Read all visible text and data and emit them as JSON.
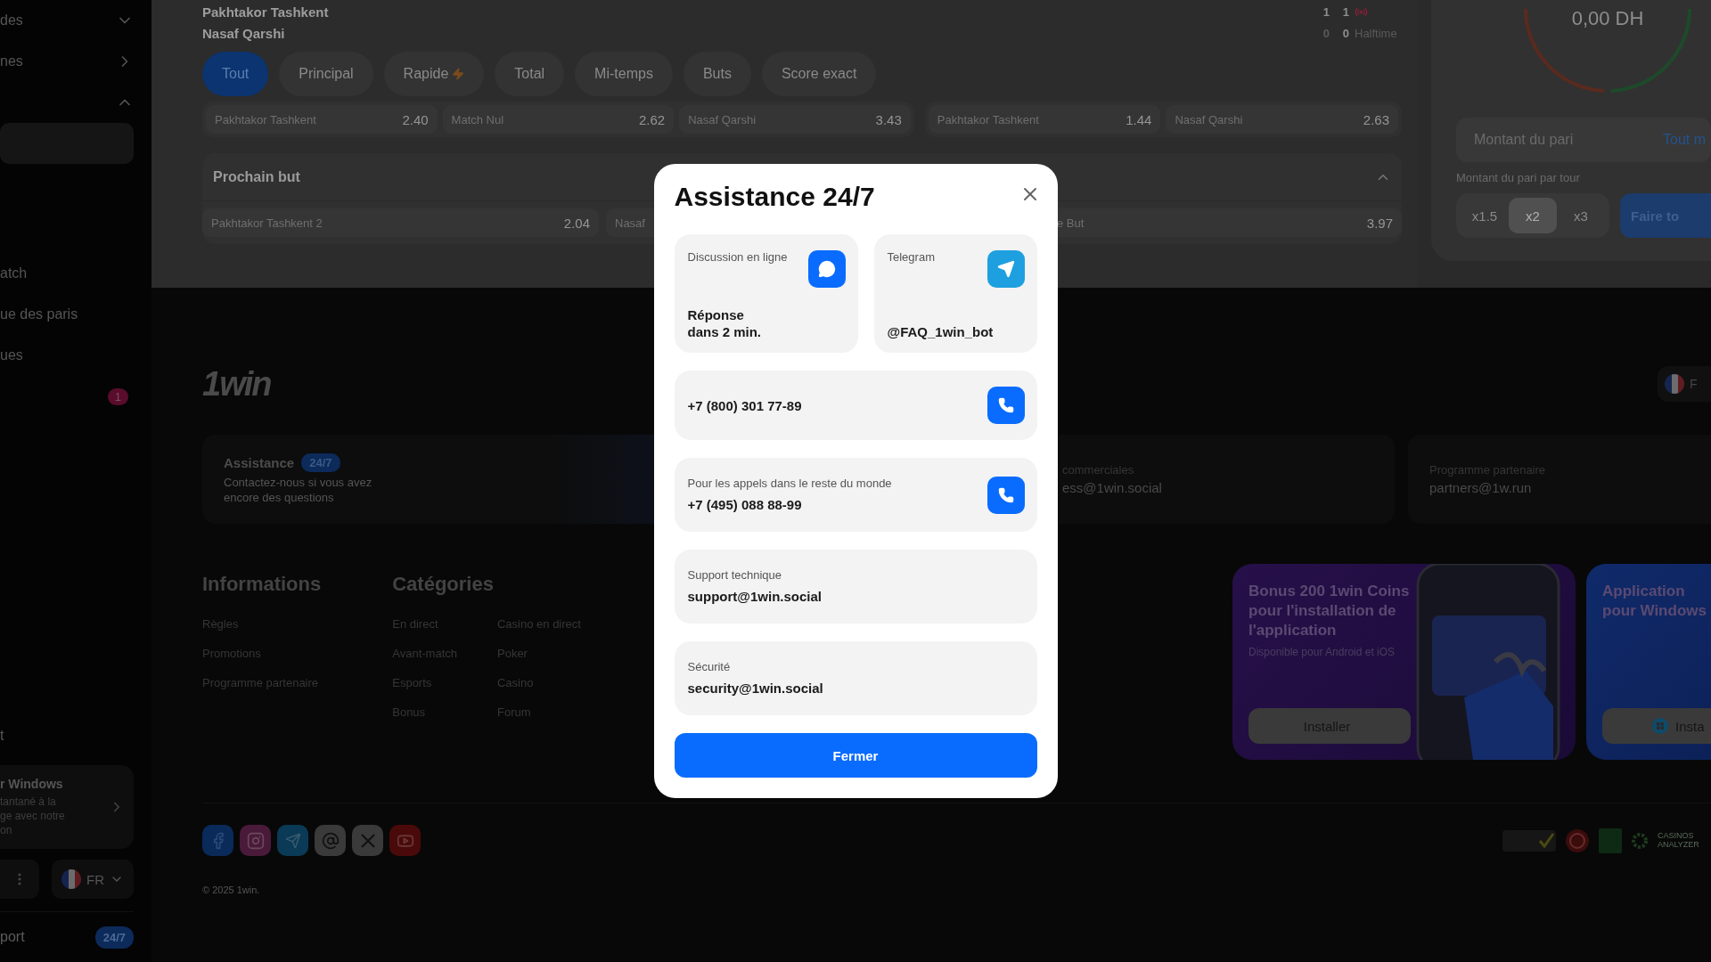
{
  "sidebar": {
    "sections": [
      {
        "items": [
          {
            "label": "des",
            "kind": "group",
            "expanded": false
          },
          {
            "label": "nes",
            "kind": "link"
          },
          {
            "kind": "group",
            "expanded": true,
            "children": [
              {
                "selected": true
              }
            ]
          }
        ]
      },
      {
        "items": [
          {
            "label": "atch",
            "selected": false
          },
          {
            "label": "ue des paris",
            "selected": false
          },
          {
            "label": "ues",
            "selected": false
          },
          {
            "selected": false,
            "badge": "1"
          }
        ]
      }
    ],
    "bottom_items": [
      {
        "label": "t",
        "selected": false
      }
    ],
    "windows_card": {
      "title": "r Windows",
      "text": "tantané à la\nge avec notre\non"
    },
    "language": "FR",
    "support": {
      "label": "port",
      "badge": "24/7"
    }
  },
  "match": {
    "teams": [
      "Pakhtakor Tashkent",
      "Nasaf Qarshi"
    ],
    "score": [
      {
        "home": "1",
        "away": "1",
        "live": true
      },
      {
        "home": "0",
        "away": "0",
        "note": "Halftime"
      }
    ],
    "market_tabs": [
      {
        "label": "Tout",
        "selected": true,
        "hot": false
      },
      {
        "label": "Principal",
        "selected": false,
        "hot": false
      },
      {
        "label": "Rapide",
        "selected": false,
        "hot": true
      },
      {
        "label": "Total",
        "selected": false,
        "hot": false
      },
      {
        "label": "Mi-temps",
        "selected": false,
        "hot": false
      },
      {
        "label": "Buts",
        "selected": false,
        "hot": false
      },
      {
        "label": "Score exact",
        "selected": false,
        "hot": false
      }
    ],
    "odds_groups": [
      [
        {
          "label": "Pakhtakor Tashkent",
          "odds": "2.40"
        },
        {
          "label": "Match Nul",
          "odds": "2.62"
        },
        {
          "label": "Nasaf Qarshi",
          "odds": "3.43"
        }
      ],
      [
        {
          "label": "Pakhtakor Tashkent",
          "odds": "1.44"
        },
        {
          "label": "Nasaf Qarshi",
          "odds": "2.63"
        }
      ]
    ],
    "next_goal": {
      "title": "Prochain but",
      "expanded": true,
      "outcomes": [
        {
          "label": "Pakhtakor Tashkent 2",
          "odds": "2.04"
        },
        {
          "label": "Nasaf"
        },
        {
          "label": "e But",
          "odds": "3.97"
        }
      ]
    }
  },
  "bet_panel": {
    "amount": "0,00 DH",
    "amount_field": {
      "placeholder": "Montant du pari"
    },
    "max_link": "Tout m",
    "multiplier_label": "Montant du pari par tour",
    "multipliers": [
      {
        "label": "x1.5",
        "selected": false
      },
      {
        "label": "x2",
        "selected": true
      },
      {
        "label": "x3",
        "selected": false
      }
    ],
    "submit_button": "Faire to"
  },
  "footer": {
    "logo": "1win",
    "language": "F",
    "contact_cards": [
      {
        "kind": "support",
        "title": "Assistance",
        "badge": "24/7",
        "text": "Contactez-nous si vous avez encore des questions"
      },
      {
        "kind": "email",
        "label": "commerciales",
        "value": "ess@1win.social"
      },
      {
        "kind": "email",
        "label": "Programme partenaire",
        "value": "partners@1w.run"
      }
    ],
    "informations": {
      "title": "Informations",
      "links": [
        "Règles",
        "Promotions",
        "Programme partenaire"
      ]
    },
    "categories": {
      "title": "Catégories",
      "columns": [
        [
          "En direct",
          "Avant-match",
          "Esports",
          "Bonus"
        ],
        [
          "Casino en direct",
          "Poker",
          "Casino",
          "Forum"
        ]
      ]
    },
    "promos": [
      {
        "kind": "mobile",
        "title": "Bonus 200 1win Coins pour l'installation de l'application",
        "subtitle": "Disponible pour Android et iOS",
        "button": "Installer"
      },
      {
        "kind": "windows",
        "title": "Application pour Windows",
        "button": "Insta"
      }
    ],
    "analyzer_logo": "CASINOS ANALYZER",
    "copyright": "© 2025 1win."
  },
  "modal": {
    "title": "Assistance 24/7",
    "tiles": [
      {
        "kind": "chat",
        "label": "Discussion en ligne",
        "value": "Réponse\ndans 2 min."
      },
      {
        "kind": "telegram",
        "label": "Telegram",
        "value": "@FAQ_1win_bot"
      }
    ],
    "contacts": [
      {
        "kind": "phone",
        "value": "+7 (800) 301 77-89"
      },
      {
        "kind": "phone",
        "label": "Pour les appels dans le reste du monde",
        "value": "+7 (495) 088 88-99"
      },
      {
        "kind": "email",
        "label": "Support technique",
        "value": "support@1win.social"
      },
      {
        "kind": "email",
        "label": "Sécurité",
        "value": "security@1win.social"
      }
    ],
    "close_button": "Fermer"
  }
}
